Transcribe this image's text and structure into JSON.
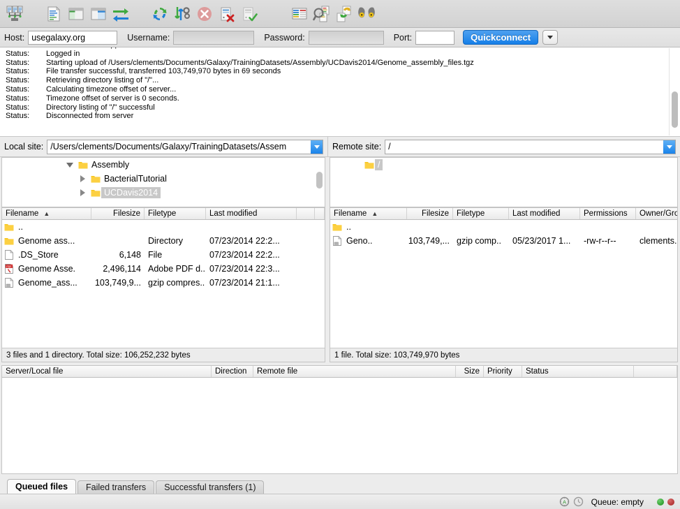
{
  "toolbar": {
    "buttons": [
      {
        "name": "site-manager-icon",
        "title": "Open the Site Manager"
      },
      {
        "name": "toggle-message-log-icon",
        "title": "Toggles the display of the message log"
      },
      {
        "name": "toggle-local-tree-icon",
        "title": "Toggles the display of the local directory tree"
      },
      {
        "name": "toggle-remote-tree-icon",
        "title": "Toggles the display of the remote directory tree"
      },
      {
        "name": "toggle-transfer-queue-icon",
        "title": "Toggles the display of the transfer queue"
      },
      {
        "name": "refresh-icon",
        "title": "Refresh the file and folder lists"
      },
      {
        "name": "process-queue-icon",
        "title": "Process queue"
      },
      {
        "name": "cancel-operation-icon",
        "title": "Cancel current operation"
      },
      {
        "name": "disconnect-icon",
        "title": "Disconnects from the currently visible server"
      },
      {
        "name": "reconnect-icon",
        "title": "Reconnects to the last used server"
      },
      {
        "name": "filter-icon",
        "title": "Open the directory listing filter dialog"
      },
      {
        "name": "compare-directories-icon",
        "title": "Toggle directory comparison"
      },
      {
        "name": "synchronized-browsing-icon",
        "title": "Toggle synchronized browsing"
      },
      {
        "name": "find-files-icon",
        "title": "Search for files recursively"
      }
    ]
  },
  "quickconnect": {
    "host_label": "Host:",
    "host_value": "usegalaxy.org",
    "host_placeholder": "",
    "username_label": "Username:",
    "username_value": "",
    "username_placeholder": "",
    "password_label": "Password:",
    "password_value": "",
    "password_placeholder": "",
    "port_label": "Port:",
    "port_value": "",
    "port_placeholder": "",
    "connect_label": "Quickconnect",
    "dropdown_icon": "chevron-down-icon"
  },
  "log": {
    "key": "Status:",
    "entries": [
      {
        "key": "Status:",
        "message": "Server does not support non-ASCII characters."
      },
      {
        "key": "Status:",
        "message": "Logged in"
      },
      {
        "key": "Status:",
        "message": "Starting upload of /Users/clements/Documents/Galaxy/TrainingDatasets/Assembly/UCDavis2014/Genome_assembly_files.tgz"
      },
      {
        "key": "Status:",
        "message": "File transfer successful, transferred 103,749,970 bytes in 69 seconds"
      },
      {
        "key": "Status:",
        "message": "Retrieving directory listing of \"/\"..."
      },
      {
        "key": "Status:",
        "message": "Calculating timezone offset of server..."
      },
      {
        "key": "Status:",
        "message": "Timezone offset of server is 0 seconds."
      },
      {
        "key": "Status:",
        "message": "Directory listing of \"/\" successful"
      },
      {
        "key": "Status:",
        "message": "Disconnected from server"
      }
    ]
  },
  "local": {
    "site_label": "Local site:",
    "site_value": "/Users/clements/Documents/Galaxy/TrainingDatasets/Assem",
    "tree": [
      {
        "label": "Assembly",
        "depth": 1,
        "expanded": true,
        "selected": false,
        "twisty": "chevron-down-icon"
      },
      {
        "label": "BacterialTutorial",
        "depth": 2,
        "expanded": false,
        "selected": false,
        "twisty": "chevron-right-icon"
      },
      {
        "label": "UCDavis2014",
        "depth": 2,
        "expanded": false,
        "selected": true,
        "twisty": "chevron-right-icon"
      }
    ],
    "columns": [
      "Filename",
      "Filesize",
      "Filetype",
      "Last modified",
      ""
    ],
    "sort_column": "Filename",
    "sort_indicator": "sort-ascending-icon",
    "rows": [
      {
        "icon": "folder-icon",
        "filename": "..",
        "filesize": "",
        "filetype": "",
        "modified": ""
      },
      {
        "icon": "folder-icon",
        "filename": "Genome ass...",
        "filesize": "",
        "filetype": "Directory",
        "modified": "07/23/2014 22:2..."
      },
      {
        "icon": "file-icon",
        "filename": ".DS_Store",
        "filesize": "6,148",
        "filetype": "File",
        "modified": "07/23/2014 22:2..."
      },
      {
        "icon": "pdf-icon",
        "filename": "Genome Asse.",
        "filesize": "2,496,114",
        "filetype": "Adobe PDF d...",
        "modified": "07/23/2014 22:3..."
      },
      {
        "icon": "archive-icon",
        "filename": "Genome_ass...",
        "filesize": "103,749,9...",
        "filetype": "gzip compres..",
        "modified": "07/23/2014 21:1..."
      }
    ],
    "status": "3 files and 1 directory. Total size: 106,252,232 bytes"
  },
  "remote": {
    "site_label": "Remote site:",
    "site_value": "/",
    "tree": [
      {
        "label": "/",
        "depth": 1,
        "expanded": false,
        "selected": true,
        "twisty": ""
      }
    ],
    "columns": [
      "Filename",
      "Filesize",
      "Filetype",
      "Last modified",
      "Permissions",
      "Owner/Group"
    ],
    "sort_column": "Filename",
    "sort_indicator": "sort-ascending-icon",
    "rows": [
      {
        "icon": "folder-icon",
        "filename": "..",
        "filesize": "",
        "filetype": "",
        "modified": "",
        "permissions": "",
        "owner": ""
      },
      {
        "icon": "archive-icon",
        "filename": "Geno..",
        "filesize": "103,749,...",
        "filetype": "gzip comp..",
        "modified": "05/23/2017 1...",
        "permissions": "-rw-r--r--",
        "owner": "clements..."
      }
    ],
    "status": "1 file. Total size: 103,749,970 bytes"
  },
  "queue": {
    "columns": [
      "Server/Local file",
      "Direction",
      "Remote file",
      "Size",
      "Priority",
      "Status",
      ""
    ],
    "rows": []
  },
  "tabs": [
    {
      "label": "Queued files",
      "active": true
    },
    {
      "label": "Failed transfers",
      "active": false
    },
    {
      "label": "Successful transfers (1)",
      "active": false
    }
  ],
  "statusbar": {
    "icons": [
      "security-icon",
      "speed-limit-icon"
    ],
    "queue_text": "Queue: empty",
    "leds": [
      "led-green",
      "led-red"
    ]
  },
  "colors": {
    "accent_blue": "#157fe8",
    "folder_yellow": "#f5c518",
    "window_bg": "#ececec",
    "led_green": "#178a17",
    "led_red": "#a11f1f"
  }
}
